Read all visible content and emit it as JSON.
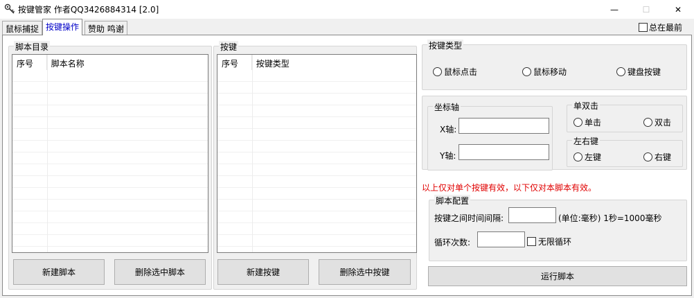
{
  "window": {
    "title": "按键管家 作者QQ3426884314  [2.0]",
    "app_icon": "gear-key-icon",
    "controls": {
      "minimize": "—",
      "maximize": "☐",
      "close": "✕"
    }
  },
  "tabs": [
    {
      "label": "鼠标捕捉",
      "active": false
    },
    {
      "label": "按键操作",
      "active": true
    },
    {
      "label": "赞助 鸣谢",
      "active": false
    }
  ],
  "always_on_top": {
    "label": "总在最前",
    "checked": false
  },
  "script_dir": {
    "group_label": "脚本目录",
    "columns": [
      "序号",
      "脚本名称"
    ],
    "rows": [],
    "new_button": "新建脚本",
    "delete_button": "删除选中脚本"
  },
  "keys": {
    "group_label": "按键",
    "columns": [
      "序号",
      "按键类型"
    ],
    "rows": [],
    "new_button": "新建按键",
    "delete_button": "删除选中按键"
  },
  "key_type": {
    "group_label": "按键类型",
    "options": [
      "鼠标点击",
      "鼠标移动",
      "键盘按键"
    ]
  },
  "coords": {
    "group_label": "坐标轴",
    "x_label": "X轴:",
    "y_label": "Y轴:",
    "x_value": "",
    "y_value": ""
  },
  "click_mode": {
    "group_label": "单双击",
    "options": [
      "单击",
      "双击"
    ]
  },
  "mouse_button": {
    "group_label": "左右键",
    "options": [
      "左键",
      "右键"
    ]
  },
  "note": "以上仅对单个按键有效，以下仅对本脚本有效。",
  "script_config": {
    "group_label": "脚本配置",
    "interval_label": "按键之间时间间隔:",
    "interval_value": "",
    "interval_unit": "(单位:毫秒) 1秒=1000毫秒",
    "loop_label": "循环次数:",
    "loop_value": "",
    "infinite_label": "无限循环",
    "infinite_checked": false
  },
  "run_button": "运行脚本"
}
